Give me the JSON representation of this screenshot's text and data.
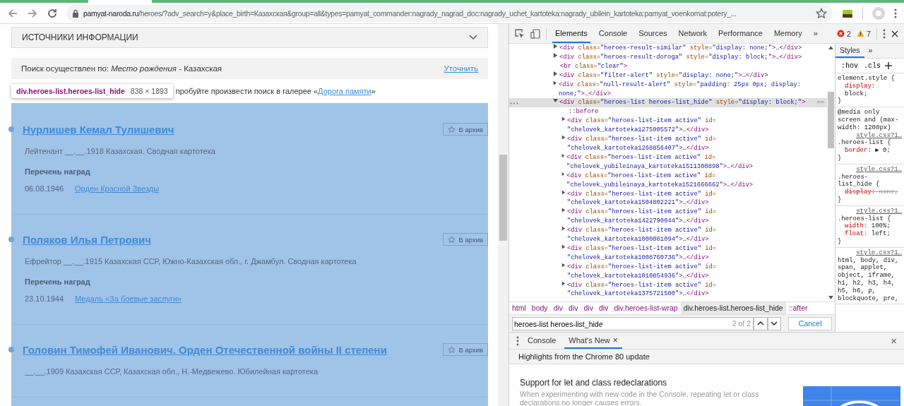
{
  "browser": {
    "url_domain": "pamyat-naroda.ru",
    "url_path": "/heroes/?adv_search=y&place_birth=Казахская&group=all&types=pamyat_commander:nagrady_nagrad_doc:nagrady_uchet_kartoteka:nagrady_ubilein_kartoteka:pamyat_voenkomat:potery_..."
  },
  "page": {
    "sources_title": "ИСТОЧНИКИ ИНФОРМАЦИИ",
    "search_info": "Поиск осуществлен по: *Место рождения* - Казахская",
    "refine_link": "Уточнить",
    "inspect_tooltip": {
      "selector": "div.heroes-list.heroes-list_hide",
      "size": "838 × 1893"
    },
    "gallery_text": "пробуйте произвести поиск в галерее «",
    "gallery_link": "Дорога памяти",
    "gallery_end": "»",
    "heroes": [
      {
        "name": "Нурлишев Кемал Тулишевич",
        "archive": "В архив",
        "details": "Лейтенант __.__.1918 Казахская. Сводная картотека",
        "awards_heading": "Перечень наград",
        "awards": [
          {
            "date": "06.08.1946",
            "title": "Орден Красной Звезды"
          }
        ]
      },
      {
        "name": "Поляков Илья Петрович",
        "archive": "В архив",
        "details": "Ефрейтор __.__.1915 Казахская ССР, Южно-Казахская обл., г. Джамбул. Сводная картотека",
        "awards_heading": "Перечень наград",
        "awards": [
          {
            "date": "23.10.1944",
            "title": "Медаль «За боевые заслуги»"
          }
        ]
      },
      {
        "name": "Головин Тимофей Иванович. Орден Отечественной войны II степени",
        "archive": "В архив",
        "details": "__.__.1909 Казахская ССР, Казахская обл., Н.-Медвежево. Юбилейная картотека"
      }
    ]
  },
  "devtools": {
    "tabs": [
      {
        "label": "Elements",
        "selected": true
      },
      {
        "label": "Console",
        "selected": false
      },
      {
        "label": "Sources",
        "selected": false
      },
      {
        "label": "Network",
        "selected": false
      },
      {
        "label": "Performance",
        "selected": false
      },
      {
        "label": "Memory",
        "selected": false
      }
    ],
    "more_tabs": "»",
    "errors": "2",
    "warnings": "7",
    "tree": [
      {
        "kind": "node",
        "expanded": false,
        "selected": false,
        "code": "<div class=\"heroes-result-similar\" style=\"display: none;\">…</div>"
      },
      {
        "kind": "node",
        "expanded": false,
        "selected": false,
        "code": "<div class=\"heroes-result-doroga\" style=\"display: block;\">…</div>"
      },
      {
        "kind": "leaf",
        "selected": false,
        "code": "<br class=\"clear\">"
      },
      {
        "kind": "node",
        "expanded": false,
        "selected": false,
        "code": "<div class=\"filter-alert\" style=\"display: none;\">…</div>"
      },
      {
        "kind": "node",
        "expanded": false,
        "selected": false,
        "code": "<div class=\"null-result-alert\" style=\"padding: 25px 0px; display: none;\">…</div>"
      },
      {
        "kind": "node",
        "expanded": true,
        "selected": true,
        "code": "<div class=\"heroes-list heroes-list_hide\" style=\"display: block;\">",
        "marker": "==",
        "children": [
          {
            "kind": "pseudo",
            "selected": false,
            "code": "::before"
          },
          {
            "kind": "node",
            "expanded": false,
            "selected": false,
            "code": "<div class=\"heroes-list-item active\" id=\"chelovek_kartoteka1275005572\">…</div>"
          },
          {
            "kind": "node",
            "expanded": false,
            "selected": false,
            "code": "<div class=\"heroes-list-item active\" id=\"chelovek_kartoteka1268856407\">…</div>"
          },
          {
            "kind": "node",
            "expanded": false,
            "selected": false,
            "code": "<div class=\"heroes-list-item active\" id=\"chelovek_yubileinaya_kartoteka1511300898\">…</div>"
          },
          {
            "kind": "node",
            "expanded": false,
            "selected": false,
            "code": "<div class=\"heroes-list-item active\" id=\"chelovek_yubileinaya_kartoteka1521666662\">…</div>"
          },
          {
            "kind": "node",
            "expanded": false,
            "selected": false,
            "code": "<div class=\"heroes-list-item active\" id=\"chelovek_kartoteka1504802221\">…</div>"
          },
          {
            "kind": "node",
            "expanded": false,
            "selected": false,
            "code": "<div class=\"heroes-list-item active\" id=\"chelovek_kartoteka1422790044\">…</div>"
          },
          {
            "kind": "node",
            "expanded": false,
            "selected": false,
            "code": "<div class=\"heroes-list-item active\" id=\"chelovek_kartoteka1000061094\">…</div>"
          },
          {
            "kind": "node",
            "expanded": false,
            "selected": false,
            "code": "<div class=\"heroes-list-item active\" id=\"chelovek_kartoteka1008760736\">…</div>"
          },
          {
            "kind": "node",
            "expanded": false,
            "selected": false,
            "code": "<div class=\"heroes-list-item active\" id=\"chelovek_kartoteka1010854936\">…</div>"
          },
          {
            "kind": "node",
            "expanded": false,
            "selected": false,
            "code": "<div class=\"heroes-list-item active\" id=\"chelovek_kartoteka1375721500\">…</div>"
          }
        ]
      }
    ],
    "breadcrumbs": [
      {
        "label": "html",
        "selected": false
      },
      {
        "label": "body",
        "selected": false
      },
      {
        "label": "div",
        "selected": false
      },
      {
        "label": "div",
        "selected": false
      },
      {
        "label": "div",
        "selected": false
      },
      {
        "label": "div",
        "selected": false
      },
      {
        "label": "div.heroes-list-wrap",
        "selected": false
      },
      {
        "label": "div.heroes-list.heroes-list_hide",
        "selected": true
      },
      {
        "label": "::after",
        "selected": false
      }
    ],
    "search": {
      "value": "heroes-list heroes-list_hide",
      "count": "2 of 2",
      "cancel": "Cancel"
    },
    "styles": {
      "tab": "Styles",
      "more": "»",
      "hov": ":hov",
      "cls": ".cls",
      "rules": [
        {
          "selector": "element.style {",
          "decls": [
            {
              "prop": "display:",
              "value": "block;",
              "overridden": false
            }
          ],
          "close": "}"
        },
        {
          "media": "@media only screen and (max-width: 1200px)",
          "source": "style.css?1…",
          "selector": ".heroes-list {",
          "decls": [
            {
              "prop": "border:",
              "value": "▶ 0;",
              "overridden": false
            }
          ],
          "close": "}"
        },
        {
          "source": "style.css?1…",
          "selector": ".heroes-list_hide {",
          "decls": [
            {
              "prop": "display:",
              "value": "none;",
              "overridden": true
            }
          ],
          "close": "}"
        },
        {
          "source": "style.css?1…",
          "selector": ".heroes-list {",
          "decls": [
            {
              "prop": "width:",
              "value": "100%;",
              "overridden": false
            },
            {
              "prop": "float:",
              "value": "left;",
              "overridden": false
            }
          ],
          "close": "}"
        },
        {
          "source": "style.css?1…",
          "selector": "html, body, div, span, applet, object, iframe, h1, h2, h3, h4, h5, h6, p, blockquote, pre,"
        }
      ]
    },
    "drawer": {
      "tabs": [
        {
          "label": "Console",
          "selected": false,
          "closable": false
        },
        {
          "label": "What's New",
          "selected": true,
          "closable": true
        }
      ],
      "close": "×",
      "tab_close": "×",
      "header": "Highlights from the Chrome 80 update",
      "card": {
        "title": "Support for let and class redeclarations",
        "description": "When experimenting with new code in the Console, repeating let or class declarations no longer causes errors."
      }
    }
  }
}
